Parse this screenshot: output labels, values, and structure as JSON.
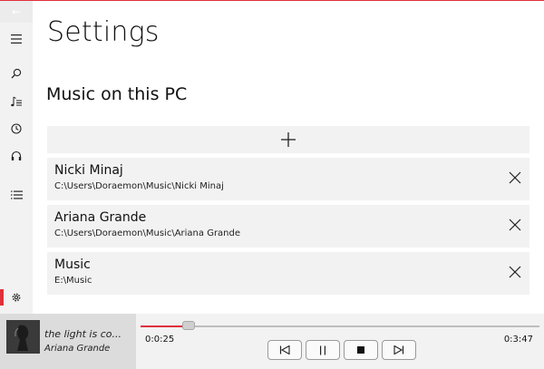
{
  "app": {
    "accent_color": "#e0303b"
  },
  "nav": {
    "back_glyph": "←",
    "items": [
      {
        "name": "hamburger-menu-icon"
      },
      {
        "name": "search-icon"
      },
      {
        "name": "music-library-icon"
      },
      {
        "name": "recent-clock-icon"
      },
      {
        "name": "now-playing-headphones-icon"
      },
      {
        "name": "playlist-icon"
      },
      {
        "name": "settings-gear-icon",
        "active": true
      }
    ]
  },
  "page": {
    "title": "Settings",
    "section_title": "Music on this PC",
    "add_icon": "plus-icon"
  },
  "folders": [
    {
      "name": "Nicki Minaj",
      "path": "C:\\Users\\Doraemon\\Music\\Nicki Minaj"
    },
    {
      "name": "Ariana Grande",
      "path": "C:\\Users\\Doraemon\\Music\\Ariana Grande"
    },
    {
      "name": "Music",
      "path": "E:\\Music"
    }
  ],
  "player": {
    "song": "the light is co...",
    "artist": "Ariana Grande",
    "current_time": "0:0:25",
    "total_time": "0:3:47",
    "progress_fraction": 0.12
  }
}
